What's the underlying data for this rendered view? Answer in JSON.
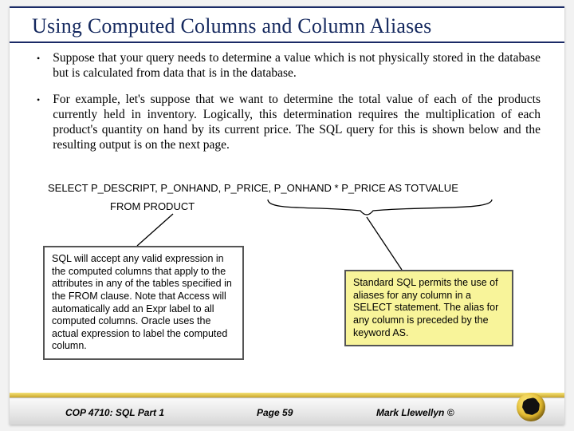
{
  "title": "Using Computed Columns and Column Aliases",
  "bullets": [
    "Suppose that your query needs to determine a value which is not physically stored in the database but is calculated from data that is in the database.",
    "For example, let's suppose that we want to determine the total value of each of the products currently held in inventory.  Logically, this determination requires the multiplication of each product's quantity on hand by its current price.  The SQL query for this is shown below and the resulting output is on the next page."
  ],
  "sql": {
    "line1_full": "SELECT  P_DESCRIPT, P_ONHAND,  P_PRICE, P_ONHAND * P_PRICE   AS TOTVALUE",
    "line2": "FROM PRODUCT"
  },
  "callouts": {
    "left": "SQL will accept any valid expression in the computed columns that apply to the attributes in any of the tables specified in the FROM clause.  Note that Access will automatically add an Expr label to all computed columns.  Oracle uses the actual expression to label the computed column.",
    "right": "Standard SQL permits the use of aliases for any column in a SELECT statement.  The alias for any column is preceded by the keyword AS."
  },
  "footer": {
    "left": "COP 4710: SQL Part 1",
    "mid": "Page 59",
    "right": "Mark Llewellyn ©"
  }
}
